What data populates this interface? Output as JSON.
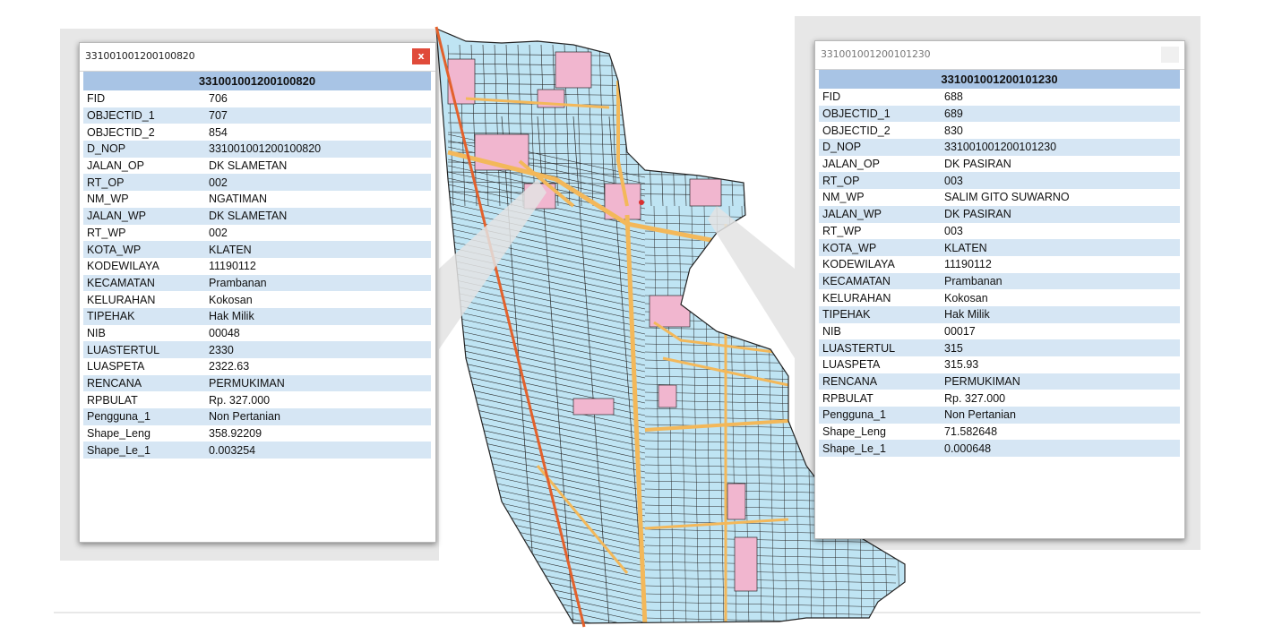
{
  "colors": {
    "parcel_fill": "#bfe4f3",
    "parcel_line": "#2a2a2a",
    "road": "#f3b85a",
    "settlement": "#f1b6cf",
    "header": "#a8c4e5",
    "row_alt": "#d6e6f4",
    "close_active": "#e04a3a",
    "close_inactive": "#f0f0f0",
    "callout": "#e3e3e3"
  },
  "icons": {
    "close": "close-icon"
  },
  "popups": [
    {
      "title": "331001001200100820",
      "close_label": "x",
      "header": "331001001200100820",
      "rows": [
        {
          "key": "FID",
          "value": "706"
        },
        {
          "key": "OBJECTID_1",
          "value": "707"
        },
        {
          "key": "OBJECTID_2",
          "value": "854"
        },
        {
          "key": "D_NOP",
          "value": "331001001200100820"
        },
        {
          "key": "JALAN_OP",
          "value": "DK SLAMETAN"
        },
        {
          "key": "RT_OP",
          "value": "002"
        },
        {
          "key": "NM_WP",
          "value": "NGATIMAN"
        },
        {
          "key": "JALAN_WP",
          "value": "DK SLAMETAN"
        },
        {
          "key": "RT_WP",
          "value": "002"
        },
        {
          "key": "KOTA_WP",
          "value": "KLATEN"
        },
        {
          "key": "KODEWILAYA",
          "value": "11190112"
        },
        {
          "key": "KECAMATAN",
          "value": "Prambanan"
        },
        {
          "key": "KELURAHAN",
          "value": "Kokosan"
        },
        {
          "key": "TIPEHAK",
          "value": "Hak Milik"
        },
        {
          "key": "NIB",
          "value": "00048"
        },
        {
          "key": "LUASTERTUL",
          "value": "2330"
        },
        {
          "key": "LUASPETA",
          "value": "2322.63"
        },
        {
          "key": "RENCANA",
          "value": "PERMUKIMAN"
        },
        {
          "key": "RPBULAT",
          "value": "Rp. 327.000"
        },
        {
          "key": "Pengguna_1",
          "value": "Non Pertanian"
        },
        {
          "key": "Shape_Leng",
          "value": "358.92209"
        },
        {
          "key": "Shape_Le_1",
          "value": "0.003254"
        }
      ]
    },
    {
      "title": "331001001200101230",
      "close_label": "x",
      "header": "331001001200101230",
      "rows": [
        {
          "key": "FID",
          "value": "688"
        },
        {
          "key": "OBJECTID_1",
          "value": "689"
        },
        {
          "key": "OBJECTID_2",
          "value": "830"
        },
        {
          "key": "D_NOP",
          "value": "331001001200101230"
        },
        {
          "key": "JALAN_OP",
          "value": "DK PASIRAN"
        },
        {
          "key": "RT_OP",
          "value": "003"
        },
        {
          "key": "NM_WP",
          "value": "SALIM GITO SUWARNO"
        },
        {
          "key": "JALAN_WP",
          "value": "DK PASIRAN"
        },
        {
          "key": "RT_WP",
          "value": "003"
        },
        {
          "key": "KOTA_WP",
          "value": "KLATEN"
        },
        {
          "key": "KODEWILAYA",
          "value": "11190112"
        },
        {
          "key": "KECAMATAN",
          "value": "Prambanan"
        },
        {
          "key": "KELURAHAN",
          "value": "Kokosan"
        },
        {
          "key": "TIPEHAK",
          "value": "Hak Milik"
        },
        {
          "key": "NIB",
          "value": "00017"
        },
        {
          "key": "LUASTERTUL",
          "value": "315"
        },
        {
          "key": "LUASPETA",
          "value": "315.93"
        },
        {
          "key": "RENCANA",
          "value": "PERMUKIMAN"
        },
        {
          "key": "RPBULAT",
          "value": "Rp. 327.000"
        },
        {
          "key": "Pengguna_1",
          "value": "Non Pertanian"
        },
        {
          "key": "Shape_Leng",
          "value": "71.582648"
        },
        {
          "key": "Shape_Le_1",
          "value": "0.000648"
        }
      ]
    }
  ]
}
